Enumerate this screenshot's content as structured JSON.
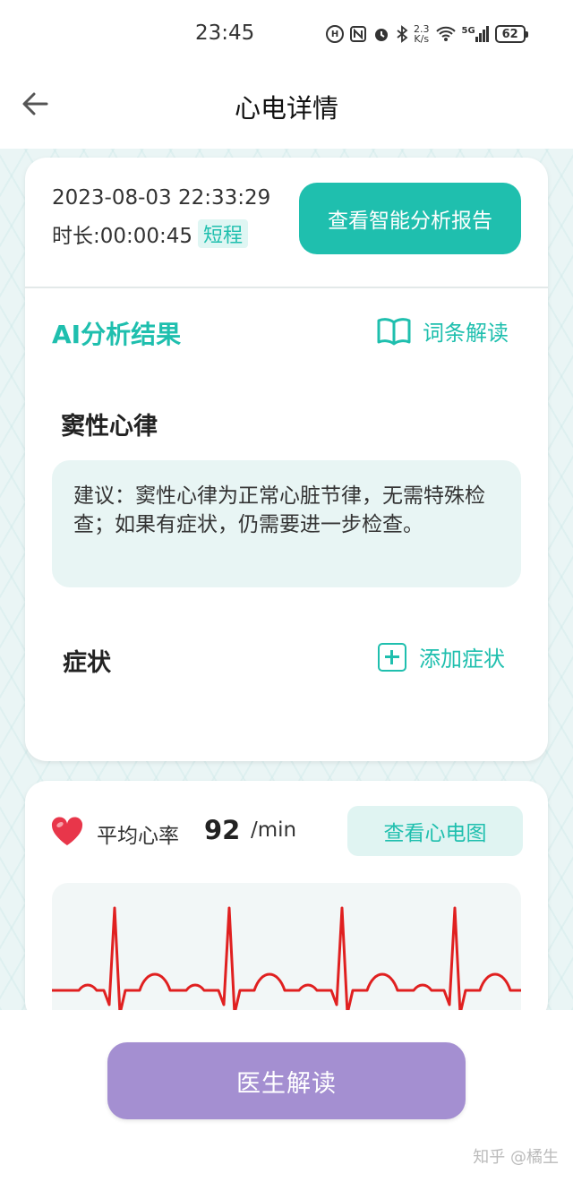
{
  "status_bar": {
    "time": "23:45",
    "net_speed_value": "2.3",
    "net_speed_unit": "K/s",
    "signal_label": "5G",
    "battery": "62",
    "icons": [
      "hd-icon",
      "nfc-icon",
      "alarm-icon",
      "bluetooth-icon",
      "wifi-icon",
      "signal-icon",
      "battery-icon"
    ]
  },
  "nav": {
    "title": "心电详情",
    "back_icon": "arrow-left-icon"
  },
  "record": {
    "datetime": "2023-08-03 22:33:29",
    "duration": "时长:00:00:45",
    "duration_tag": "短程",
    "report_button": "查看智能分析报告"
  },
  "analysis": {
    "title": "AI分析结果",
    "glossary_label": "词条解读",
    "rhythm": "窦性心律",
    "advice": "建议：窦性心律为正常心脏节律，无需特殊检查；如果有症状，仍需要进一步检查。"
  },
  "symptoms": {
    "label": "症状",
    "add_label": "添加症状"
  },
  "heart_rate": {
    "label": "平均心率",
    "value": "92",
    "unit": "/min",
    "ecg_button": "查看心电图"
  },
  "bottom": {
    "doctor_button": "医生解读",
    "watermark": "知乎 @橘生"
  },
  "colors": {
    "accent": "#1fbfae",
    "doctor_button": "#a48fd1",
    "ecg_line": "#e02020",
    "heart": "#e8364a"
  }
}
